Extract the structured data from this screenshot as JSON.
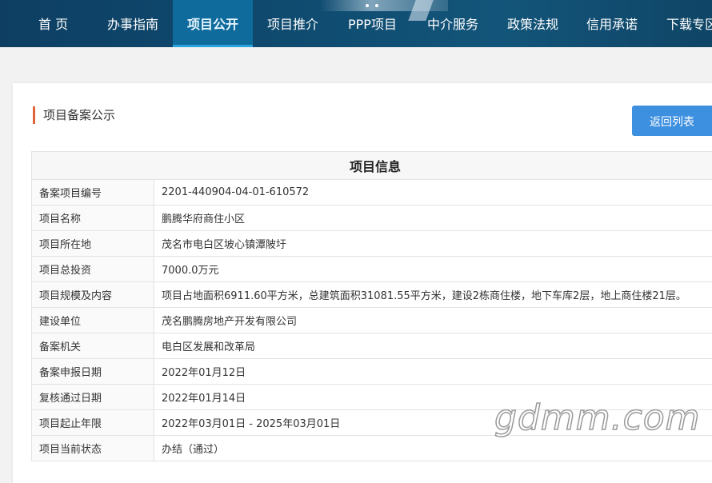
{
  "nav": {
    "items": [
      {
        "label": "首 页",
        "active": false
      },
      {
        "label": "办事指南",
        "active": false
      },
      {
        "label": "项目公开",
        "active": true
      },
      {
        "label": "项目推介",
        "active": false
      },
      {
        "label": "PPP项目",
        "active": false
      },
      {
        "label": "中介服务",
        "active": false
      },
      {
        "label": "政策法规",
        "active": false
      },
      {
        "label": "信用承诺",
        "active": false
      },
      {
        "label": "下载专区",
        "active": false
      }
    ]
  },
  "section": {
    "title": "项目备案公示",
    "back_label": "返回列表"
  },
  "table": {
    "header": "项目信息",
    "rows": [
      {
        "label": "备案项目编号",
        "value": "2201-440904-04-01-610572"
      },
      {
        "label": "项目名称",
        "value": "鹏腾华府商住小区"
      },
      {
        "label": "项目所在地",
        "value": "茂名市电白区坡心镇潭陂圩"
      },
      {
        "label": "项目总投资",
        "value": "7000.0万元"
      },
      {
        "label": "项目规模及内容",
        "value": "项目占地面积6911.60平方米，总建筑面积31081.55平方米，建设2栋商住楼，地下车库2层，地上商住楼21层。"
      },
      {
        "label": "建设单位",
        "value": "茂名鹏腾房地产开发有限公司"
      },
      {
        "label": "备案机关",
        "value": "电白区发展和改革局"
      },
      {
        "label": "备案申报日期",
        "value": "2022年01月12日"
      },
      {
        "label": "复核通过日期",
        "value": "2022年01月14日"
      },
      {
        "label": "项目起止年限",
        "value": "2022年03月01日 - 2025年03月01日"
      },
      {
        "label": "项目当前状态",
        "value": "办结（通过）"
      }
    ]
  },
  "watermark": "gdmm.com",
  "colors": {
    "nav_bg": "#0f4a6f",
    "nav_active": "#0f6b9b",
    "accent": "#29a3de",
    "button": "#3d8fdf",
    "title_mark": "#e0633a"
  }
}
